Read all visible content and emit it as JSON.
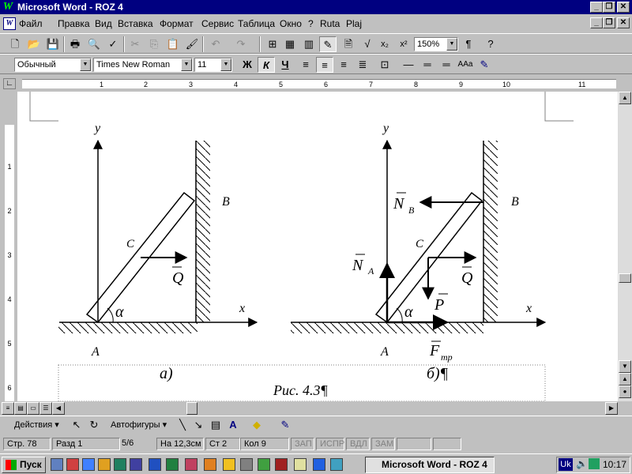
{
  "window": {
    "title": "Microsoft Word - ROZ 4",
    "app_icon": "W"
  },
  "menu": [
    "Файл",
    "Правка",
    "Вид",
    "Вставка",
    "Формат",
    "Сервис",
    "Таблица",
    "Окно",
    "?",
    "Ruta",
    "Plaj"
  ],
  "toolbar": {
    "zoom": "150%",
    "paragraph_mark": "¶"
  },
  "format_bar": {
    "style": "Обычный",
    "font": "Times New Roman",
    "size": "11",
    "bold": "Ж",
    "italic": "К",
    "underline": "Ч"
  },
  "ruler": {
    "h_numbers": [
      "1",
      "2",
      "3",
      "4",
      "5",
      "6",
      "7",
      "8",
      "9",
      "10",
      "11"
    ],
    "v_numbers": [
      "1",
      "2",
      "3",
      "4",
      "5",
      "6"
    ]
  },
  "figure": {
    "left": {
      "y": "y",
      "x": "x",
      "B": "B",
      "C": "C",
      "A": "A",
      "alpha": "α",
      "Q": "Q",
      "label": "а)"
    },
    "right": {
      "y": "y",
      "x": "x",
      "B": "B",
      "C": "C",
      "A": "A",
      "alpha": "α",
      "Q": "Q",
      "P": "P",
      "NB": "N",
      "NB_sub": "B",
      "NA": "N",
      "NA_sub": "A",
      "F": "F",
      "F_sub": "тр",
      "label": "б)¶"
    },
    "caption": "Рис. 4.3¶"
  },
  "drawing": {
    "actions": "Действия ▾",
    "autoshapes": "Автофигуры ▾"
  },
  "status": {
    "page": "Стр. 78",
    "section": "Разд 1",
    "pages": "5/6",
    "at": "На 12,3см",
    "line": "Ст 2",
    "col": "Кол 9",
    "rec": "ЗАП",
    "trk": "ИСПР",
    "ext": "ВДЛ",
    "ovr": "ЗАМ"
  },
  "taskbar": {
    "start": "Пуск",
    "task": "Microsoft Word - ROZ 4",
    "lang": "Uk",
    "time": "10:17"
  },
  "colors": {
    "titlebar": "#000080",
    "face": "#c0c0c0"
  }
}
